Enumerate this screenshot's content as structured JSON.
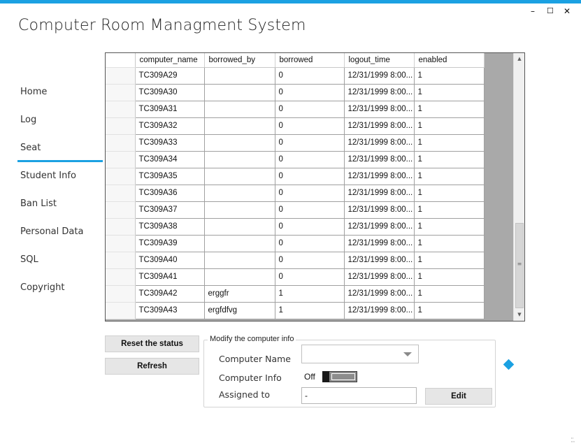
{
  "window": {
    "title": "Computer Room Managment System",
    "minimize_glyph": "–",
    "maximize_glyph": "☐",
    "close_glyph": "✕"
  },
  "nav": {
    "items": [
      "Home",
      "Log",
      "Seat",
      "Student Info",
      "Ban List",
      "Personal Data",
      "SQL",
      "Copyright"
    ],
    "active": "Seat"
  },
  "grid": {
    "columns": [
      "computer_name",
      "borrowed_by",
      "borrowed",
      "logout_time",
      "enabled"
    ],
    "rows": [
      [
        "TC309A29",
        "",
        "0",
        "12/31/1999 8:00...",
        "1"
      ],
      [
        "TC309A30",
        "",
        "0",
        "12/31/1999 8:00...",
        "1"
      ],
      [
        "TC309A31",
        "",
        "0",
        "12/31/1999 8:00...",
        "1"
      ],
      [
        "TC309A32",
        "",
        "0",
        "12/31/1999 8:00...",
        "1"
      ],
      [
        "TC309A33",
        "",
        "0",
        "12/31/1999 8:00...",
        "1"
      ],
      [
        "TC309A34",
        "",
        "0",
        "12/31/1999 8:00...",
        "1"
      ],
      [
        "TC309A35",
        "",
        "0",
        "12/31/1999 8:00...",
        "1"
      ],
      [
        "TC309A36",
        "",
        "0",
        "12/31/1999 8:00...",
        "1"
      ],
      [
        "TC309A37",
        "",
        "0",
        "12/31/1999 8:00...",
        "1"
      ],
      [
        "TC309A38",
        "",
        "0",
        "12/31/1999 8:00...",
        "1"
      ],
      [
        "TC309A39",
        "",
        "0",
        "12/31/1999 8:00...",
        "1"
      ],
      [
        "TC309A40",
        "",
        "0",
        "12/31/1999 8:00...",
        "1"
      ],
      [
        "TC309A41",
        "",
        "0",
        "12/31/1999 8:00...",
        "1"
      ],
      [
        "TC309A42",
        "erggfr",
        "1",
        "12/31/1999 8:00...",
        "1"
      ],
      [
        "TC309A43",
        "ergfdfvg",
        "1",
        "12/31/1999 8:00...",
        "1"
      ]
    ],
    "scroll_up_glyph": "▲",
    "scroll_down_glyph": "▼",
    "scroll_grip_glyph": "≡"
  },
  "actions": {
    "reset_label": "Reset the status",
    "refresh_label": "Refresh"
  },
  "modify": {
    "legend": "Modify the computer info",
    "computer_name_label": "Computer Name",
    "computer_name_value": "",
    "computer_info_label": "Computer Info",
    "toggle_state_label": "Off",
    "assigned_to_label": "Assigned to",
    "assigned_to_value": "-",
    "edit_label": "Edit"
  },
  "colors": {
    "accent": "#1ba1e2",
    "grid_background": "#a9a9a9"
  },
  "icons": {
    "combo_arrow": "chevron-down-icon",
    "status_diamond": "diamond-icon",
    "resize": "resize-grip-icon"
  }
}
